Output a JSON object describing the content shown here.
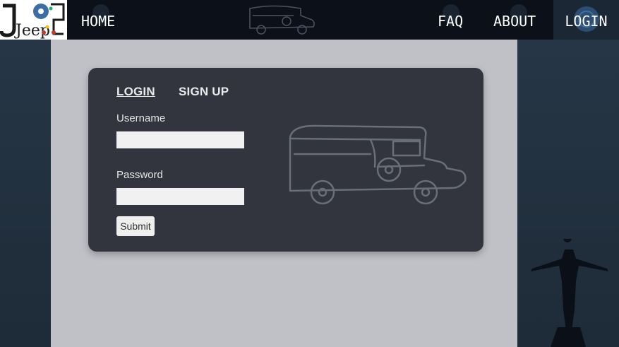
{
  "logo": {
    "text": "Jeep"
  },
  "nav": {
    "home": "HOME",
    "faq": "FAQ",
    "about": "ABOUT",
    "login": "LOGIN"
  },
  "auth": {
    "tabs": {
      "login": "LOGIN",
      "signup": "SIGN UP"
    },
    "username_label": "Username",
    "password_label": "Password",
    "username_value": "",
    "password_value": "",
    "submit_label": "Submit"
  },
  "colors": {
    "navbar": "#0c1119",
    "card": "#32353d",
    "content": "#bfc1c6",
    "side": "#22303e"
  }
}
